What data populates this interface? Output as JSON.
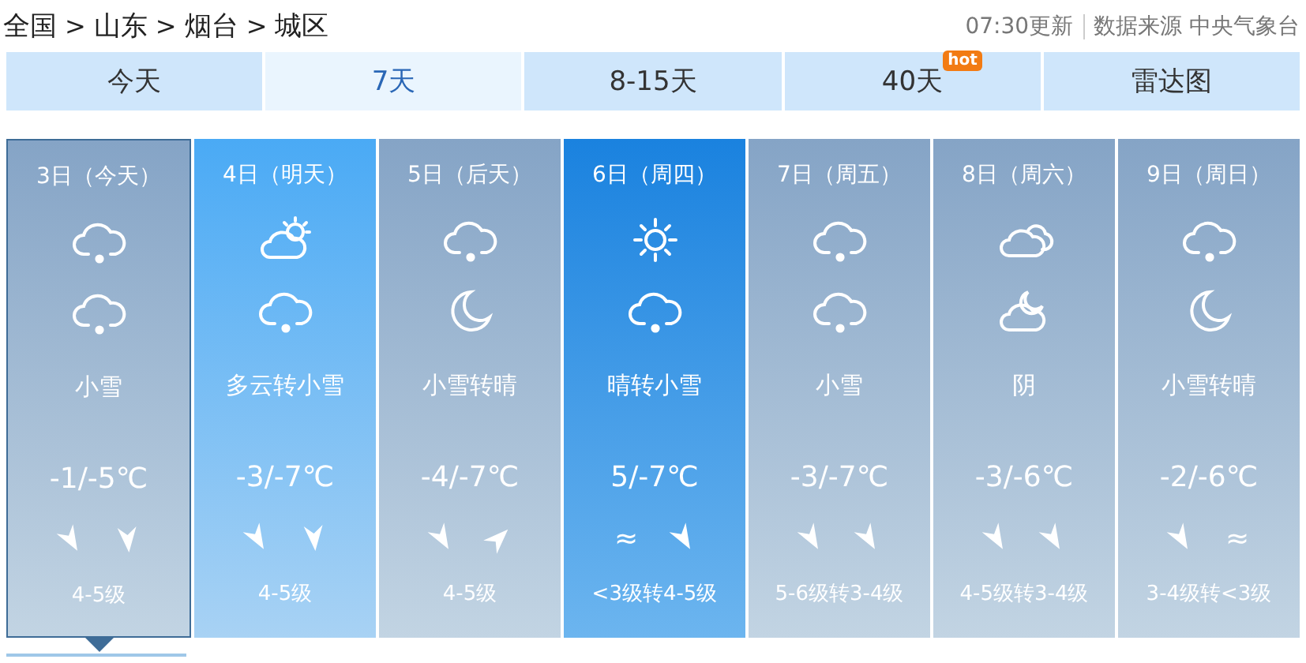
{
  "breadcrumb": [
    "全国",
    "山东",
    "烟台",
    "城区"
  ],
  "breadcrumb_separator": ">",
  "update_time": "07:30更新",
  "source": "数据来源 中央气象台",
  "tabs": [
    {
      "label": "今天",
      "selected": false
    },
    {
      "label": "7天",
      "selected": true
    },
    {
      "label": "8-15天",
      "selected": false
    },
    {
      "label": "40天",
      "selected": false,
      "badge": "hot"
    },
    {
      "label": "雷达图",
      "selected": false
    }
  ],
  "days": [
    {
      "date": "3日（今天）",
      "selected": true,
      "kind": "grey",
      "icons": [
        {
          "kind": "snow"
        },
        {
          "kind": "snow"
        }
      ],
      "weather": "小雪",
      "temp": "-1/-5℃",
      "wind": [
        {
          "kind": "arrowdownright"
        },
        {
          "kind": "arrowdown"
        }
      ],
      "wind_level": "4-5级"
    },
    {
      "date": "4日（明天）",
      "selected": false,
      "kind": "light",
      "icons": [
        {
          "kind": "cloudsun"
        },
        {
          "kind": "snow"
        }
      ],
      "weather": "多云转小雪",
      "temp": "-3/-7℃",
      "wind": [
        {
          "kind": "arrowdownright"
        },
        {
          "kind": "arrowdown"
        }
      ],
      "wind_level": "4-5级"
    },
    {
      "date": "5日（后天）",
      "selected": false,
      "kind": "grey",
      "icons": [
        {
          "kind": "snow"
        },
        {
          "kind": "moon"
        }
      ],
      "weather": "小雪转晴",
      "temp": "-4/-7℃",
      "wind": [
        {
          "kind": "arrowdownright"
        },
        {
          "kind": "arrowupright"
        }
      ],
      "wind_level": "4-5级"
    },
    {
      "date": "6日（周四）",
      "selected": false,
      "kind": "bright",
      "icons": [
        {
          "kind": "sun"
        },
        {
          "kind": "snow"
        }
      ],
      "weather": "晴转小雪",
      "temp": "5/-7℃",
      "wind": [
        {
          "kind": "text",
          "text": "≈"
        },
        {
          "kind": "arrowdownright"
        }
      ],
      "wind_level": "<3级转4-5级"
    },
    {
      "date": "7日（周五）",
      "selected": false,
      "kind": "grey",
      "icons": [
        {
          "kind": "snow"
        },
        {
          "kind": "snow"
        }
      ],
      "weather": "小雪",
      "temp": "-3/-7℃",
      "wind": [
        {
          "kind": "arrowdownright"
        },
        {
          "kind": "arrowdownright"
        }
      ],
      "wind_level": "5-6级转3-4级"
    },
    {
      "date": "8日（周六）",
      "selected": false,
      "kind": "grey",
      "icons": [
        {
          "kind": "clouds"
        },
        {
          "kind": "cloudmoon"
        }
      ],
      "weather": "阴",
      "temp": "-3/-6℃",
      "wind": [
        {
          "kind": "arrowdownright"
        },
        {
          "kind": "arrowdownright"
        }
      ],
      "wind_level": "4-5级转3-4级"
    },
    {
      "date": "9日（周日）",
      "selected": false,
      "kind": "grey",
      "icons": [
        {
          "kind": "snow"
        },
        {
          "kind": "moon"
        }
      ],
      "weather": "小雪转晴",
      "temp": "-2/-6℃",
      "wind": [
        {
          "kind": "arrowdownright"
        },
        {
          "kind": "text",
          "text": "≈"
        }
      ],
      "wind_level": "3-4级转<3级"
    }
  ]
}
